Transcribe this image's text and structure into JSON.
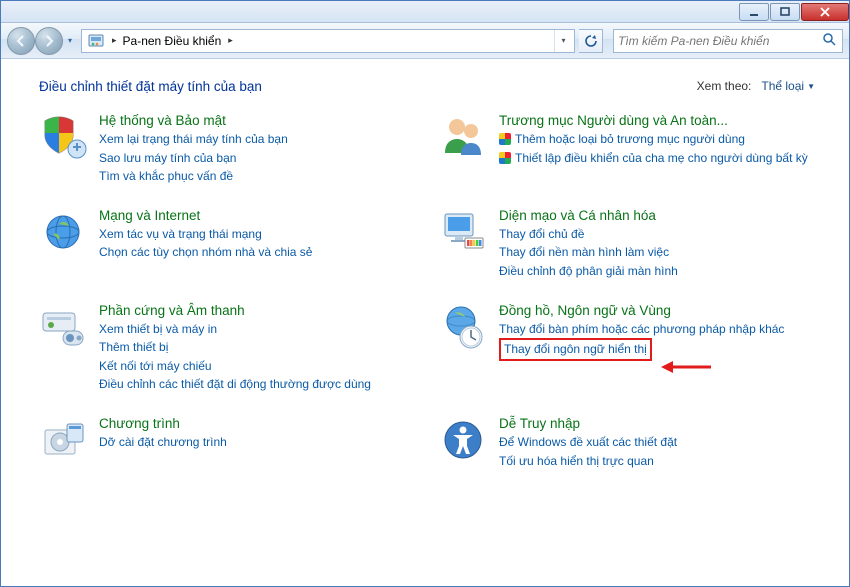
{
  "breadcrumb": {
    "label": "Pa-nen Điều khiển"
  },
  "search": {
    "placeholder": "Tìm kiếm Pa-nen Điều khiển"
  },
  "page": {
    "title": "Điều chỉnh thiết đặt máy tính của bạn",
    "view_by_label": "Xem theo:",
    "view_by_value": "Thể loại"
  },
  "categories": {
    "system": {
      "title": "Hệ thống và Bảo mật",
      "tasks": [
        "Xem lại trạng thái máy tính của bạn",
        "Sao lưu máy tính của bạn",
        "Tìm và khắc phục vấn đề"
      ]
    },
    "users": {
      "title": "Trương mục Người dùng và An toàn...",
      "tasks": [
        "Thêm hoặc loại bỏ trương mục người dùng",
        "Thiết lập điều khiển của cha mẹ cho người dùng bất kỳ"
      ]
    },
    "network": {
      "title": "Mạng và Internet",
      "tasks": [
        "Xem tác vụ và trạng thái mạng",
        "Chọn các tùy chọn nhóm nhà và chia sẻ"
      ]
    },
    "appearance": {
      "title": "Diện mạo và Cá nhân hóa",
      "tasks": [
        "Thay đổi chủ đề",
        "Thay đổi nền màn hình làm việc",
        "Điều chỉnh độ phân giải màn hình"
      ]
    },
    "hardware": {
      "title": "Phần cứng và Âm thanh",
      "tasks": [
        "Xem thiết bị và máy in",
        "Thêm thiết bị",
        "Kết nối tới máy chiếu",
        "Điều chỉnh các thiết đặt di động thường được dùng"
      ]
    },
    "clock": {
      "title": "Đồng hồ, Ngôn ngữ và Vùng",
      "tasks": [
        "Thay đổi bàn phím hoặc các phương pháp nhập khác",
        "Thay đổi ngôn ngữ hiển thị"
      ]
    },
    "programs": {
      "title": "Chương trình",
      "tasks": [
        "Dỡ cài đặt chương trình"
      ]
    },
    "ease": {
      "title": "Dễ Truy nhập",
      "tasks": [
        "Để Windows đề xuất các thiết đặt",
        "Tối ưu hóa hiển thị trực quan"
      ]
    }
  }
}
